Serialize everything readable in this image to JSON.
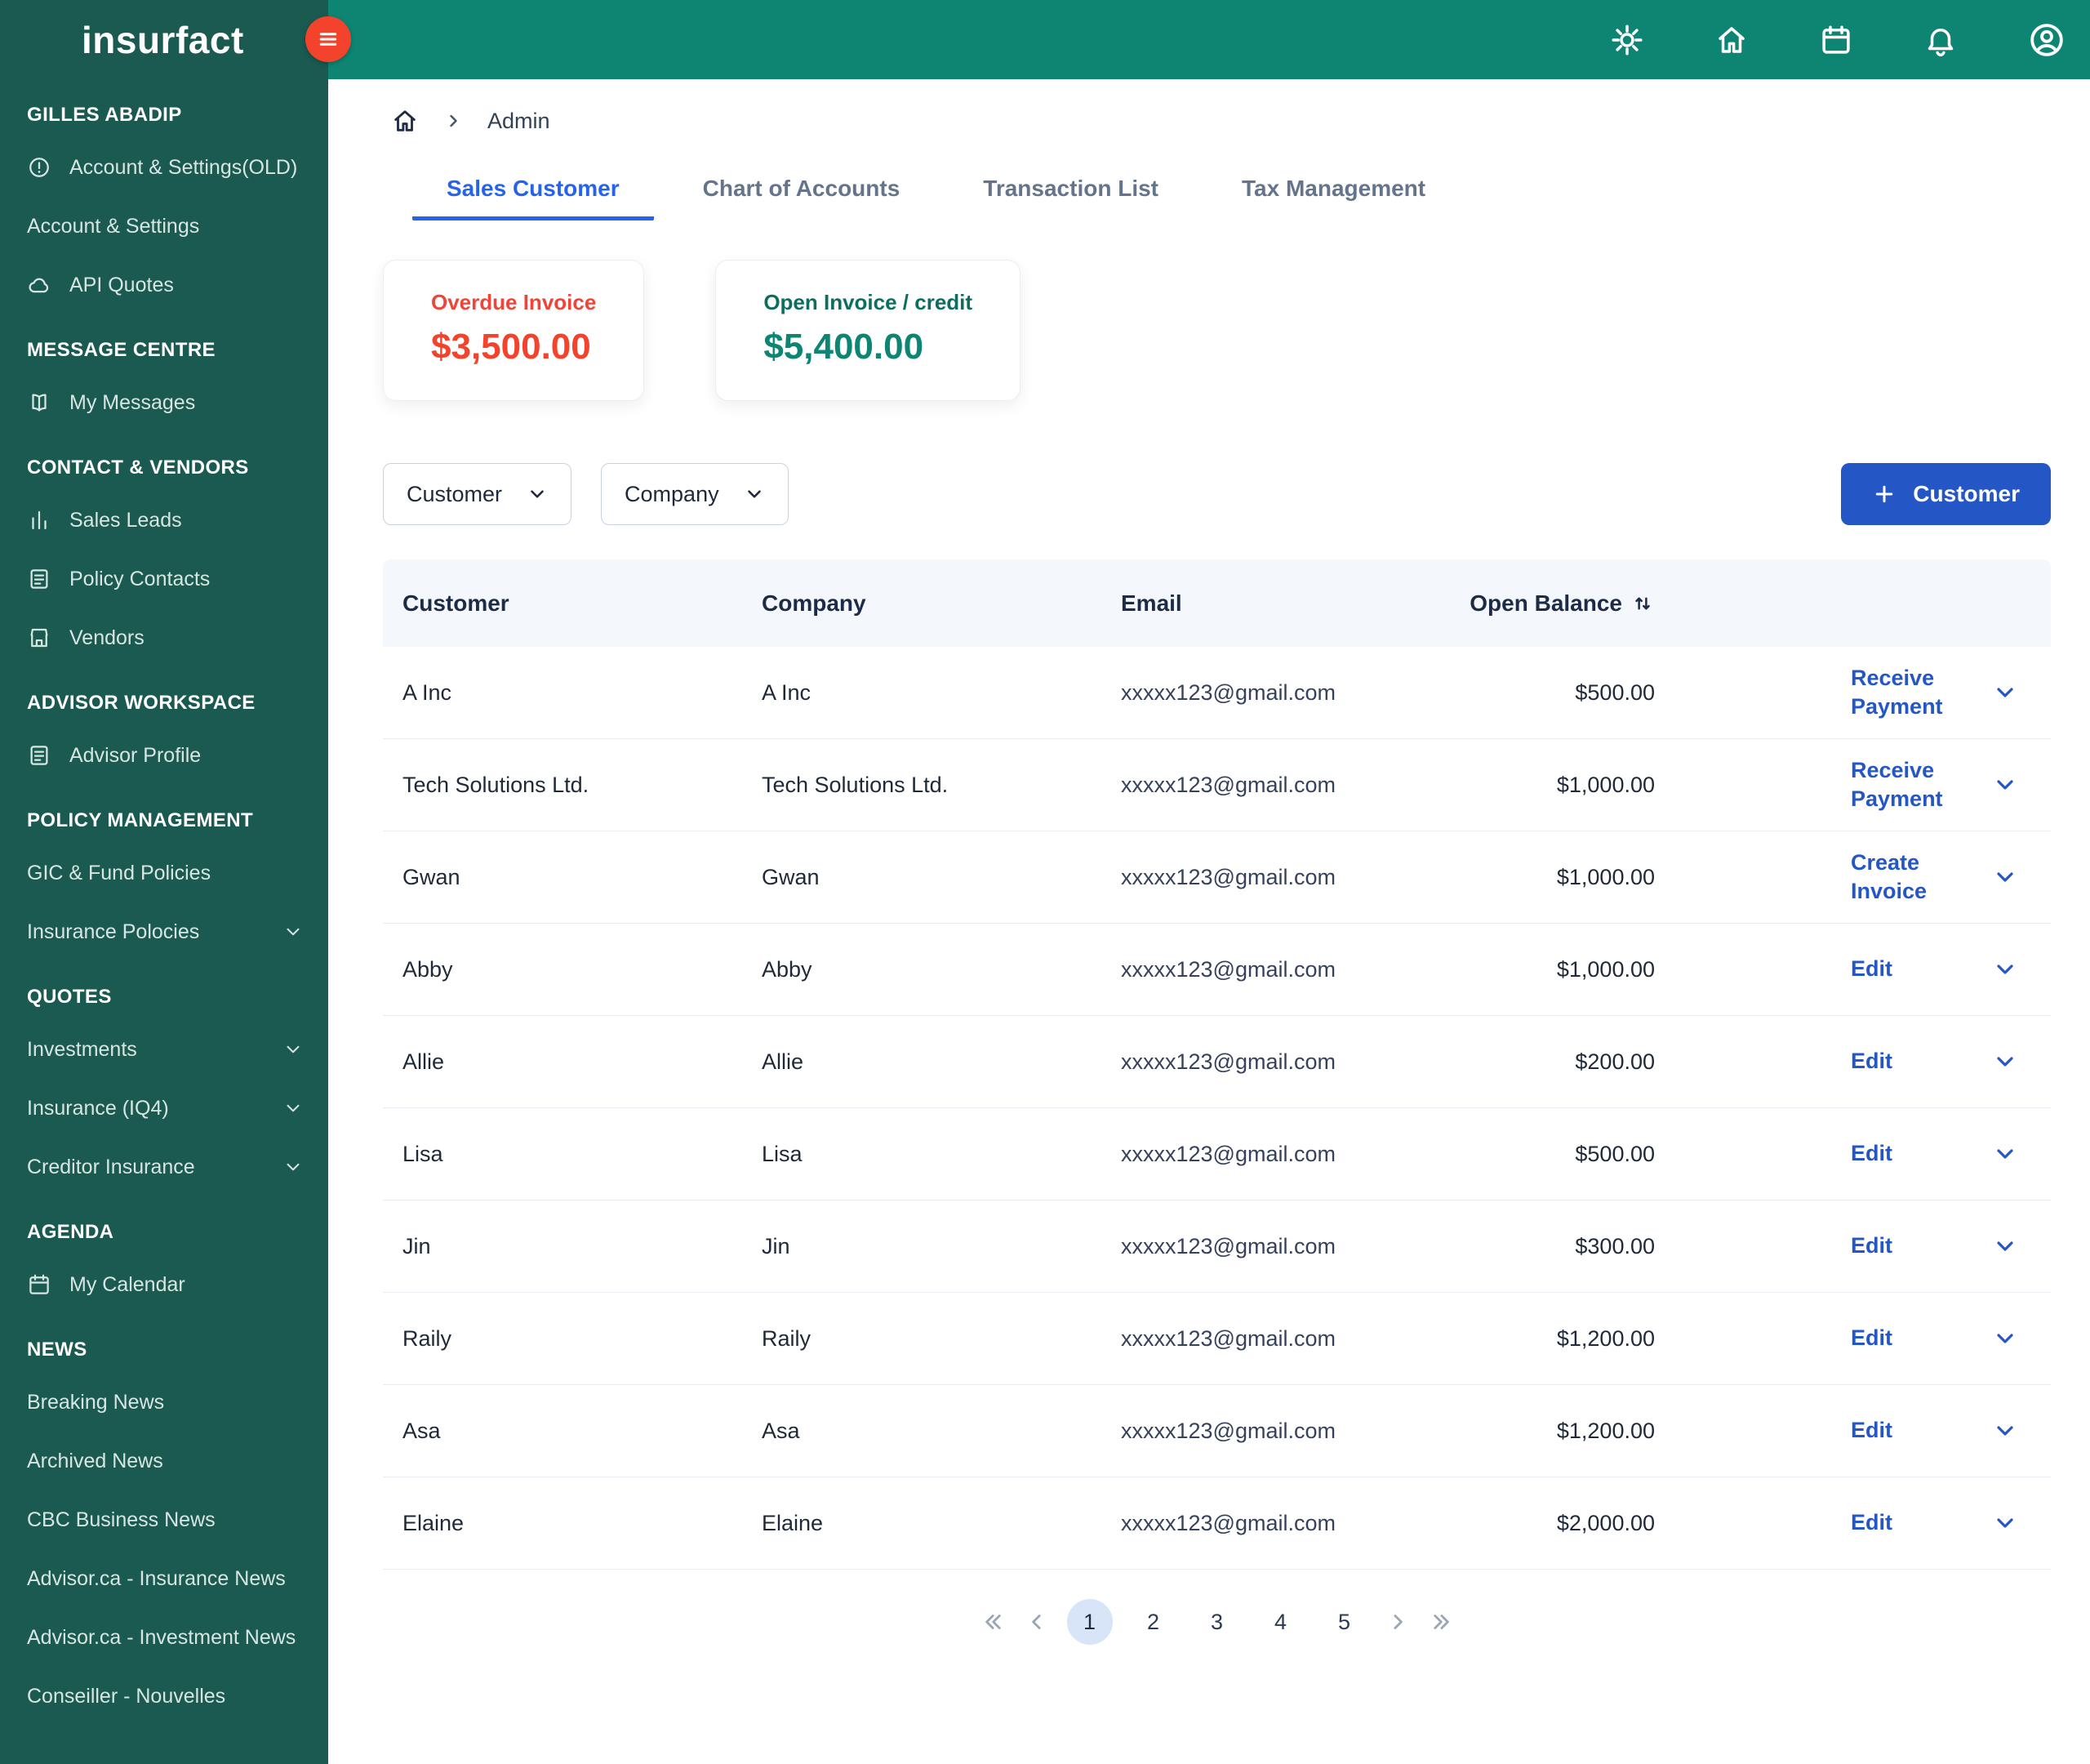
{
  "app": {
    "name": "insurfact"
  },
  "topbar": {
    "icons": [
      "settings",
      "home",
      "calendar",
      "notifications",
      "profile"
    ]
  },
  "sidebar": {
    "sections": [
      {
        "header": "GILLES ABADIP",
        "items": [
          {
            "label": "Account & Settings(OLD)",
            "icon": "alert-circle-icon"
          },
          {
            "label": "Account & Settings",
            "icon": ""
          },
          {
            "label": "API Quotes",
            "icon": "cloud-icon"
          }
        ]
      },
      {
        "header": "MESSAGE CENTRE",
        "items": [
          {
            "label": "My Messages",
            "icon": "book-icon"
          }
        ]
      },
      {
        "header": "CONTACT & VENDORS",
        "items": [
          {
            "label": "Sales Leads",
            "icon": "chart-icon"
          },
          {
            "label": "Policy Contacts",
            "icon": "document-icon"
          },
          {
            "label": "Vendors",
            "icon": "storefront-icon"
          }
        ]
      },
      {
        "header": "ADVISOR WORKSPACE",
        "items": [
          {
            "label": "Advisor Profile",
            "icon": "document-icon"
          }
        ]
      },
      {
        "header": "POLICY MANAGEMENT",
        "items": [
          {
            "label": "GIC & Fund Policies",
            "icon": ""
          },
          {
            "label": "Insurance Polocies",
            "icon": "",
            "expandable": true
          }
        ]
      },
      {
        "header": "QUOTES",
        "items": [
          {
            "label": "Investments",
            "icon": "",
            "expandable": true
          },
          {
            "label": "Insurance (IQ4)",
            "icon": "",
            "expandable": true
          },
          {
            "label": "Creditor Insurance",
            "icon": "",
            "expandable": true
          }
        ]
      },
      {
        "header": "AGENDA",
        "items": [
          {
            "label": "My Calendar",
            "icon": "calendar-icon"
          }
        ]
      },
      {
        "header": "NEWS",
        "items": [
          {
            "label": "Breaking News",
            "icon": ""
          },
          {
            "label": "Archived News",
            "icon": ""
          },
          {
            "label": "CBC Business News",
            "icon": ""
          },
          {
            "label": "Advisor.ca - Insurance News",
            "icon": ""
          },
          {
            "label": "Advisor.ca - Investment News",
            "icon": ""
          },
          {
            "label": "Conseiller - Nouvelles",
            "icon": ""
          }
        ]
      }
    ]
  },
  "breadcrumb": {
    "current": "Admin"
  },
  "tabs": [
    {
      "label": "Sales Customer",
      "active": true
    },
    {
      "label": "Chart of Accounts",
      "active": false
    },
    {
      "label": "Transaction List",
      "active": false
    },
    {
      "label": "Tax Management",
      "active": false
    }
  ],
  "summary_cards": [
    {
      "title": "Overdue Invoice",
      "amount": "$3,500.00",
      "accent": "#F04438"
    },
    {
      "title": "Open Invoice / credit",
      "amount": "$5,400.00",
      "accent": "#0D8573"
    }
  ],
  "filters": {
    "customer": "Customer",
    "company": "Company"
  },
  "actions": {
    "add_customer": "Customer"
  },
  "table": {
    "columns": {
      "customer": "Customer",
      "company": "Company",
      "email": "Email",
      "balance": "Open Balance"
    },
    "rows": [
      {
        "customer": "A Inc",
        "company": "A Inc",
        "email": "xxxxx123@gmail.com",
        "balance": "$500.00",
        "action": "Receive Payment"
      },
      {
        "customer": "Tech Solutions Ltd.",
        "company": "Tech Solutions Ltd.",
        "email": "xxxxx123@gmail.com",
        "balance": "$1,000.00",
        "action": "Receive Payment"
      },
      {
        "customer": "Gwan",
        "company": "Gwan",
        "email": "xxxxx123@gmail.com",
        "balance": "$1,000.00",
        "action": "Create Invoice"
      },
      {
        "customer": "Abby",
        "company": "Abby",
        "email": "xxxxx123@gmail.com",
        "balance": "$1,000.00",
        "action": "Edit"
      },
      {
        "customer": "Allie",
        "company": "Allie",
        "email": "xxxxx123@gmail.com",
        "balance": "$200.00",
        "action": "Edit"
      },
      {
        "customer": "Lisa",
        "company": "Lisa",
        "email": "xxxxx123@gmail.com",
        "balance": "$500.00",
        "action": "Edit"
      },
      {
        "customer": "Jin",
        "company": "Jin",
        "email": "xxxxx123@gmail.com",
        "balance": "$300.00",
        "action": "Edit"
      },
      {
        "customer": "Raily",
        "company": "Raily",
        "email": "xxxxx123@gmail.com",
        "balance": "$1,200.00",
        "action": "Edit"
      },
      {
        "customer": "Asa",
        "company": "Asa",
        "email": "xxxxx123@gmail.com",
        "balance": "$1,200.00",
        "action": "Edit"
      },
      {
        "customer": "Elaine",
        "company": "Elaine",
        "email": "xxxxx123@gmail.com",
        "balance": "$2,000.00",
        "action": "Edit"
      }
    ]
  },
  "pagination": {
    "pages": [
      "1",
      "2",
      "3",
      "4",
      "5"
    ],
    "active": "1"
  }
}
